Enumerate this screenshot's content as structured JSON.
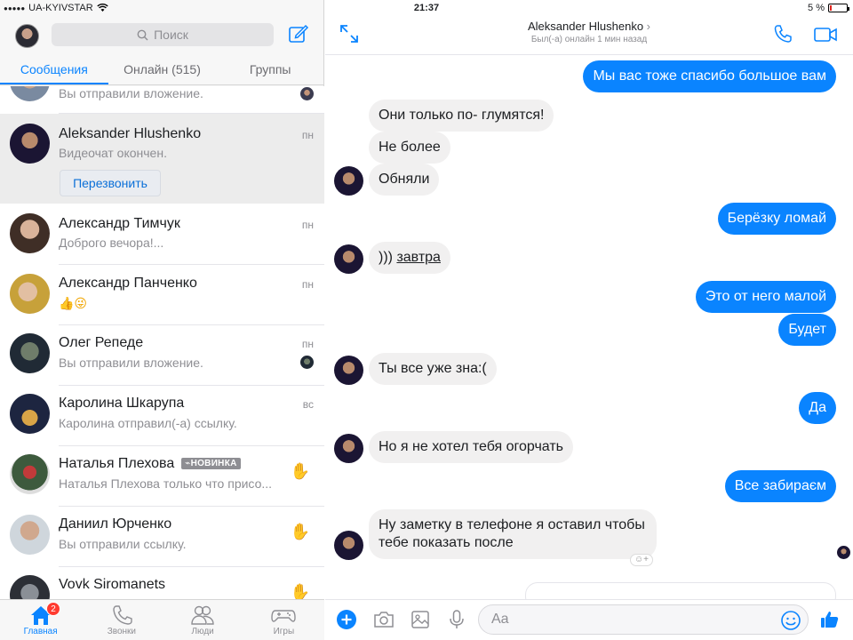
{
  "status": {
    "carrier": "UA-KYIVSTAR",
    "time": "21:37",
    "battery": "5 %",
    "battery_level": 0.05
  },
  "left": {
    "search_placeholder": "Поиск",
    "tabs": [
      {
        "label": "Сообщения",
        "active": true
      },
      {
        "label": "Онлайн (515)",
        "active": false
      },
      {
        "label": "Группы",
        "active": false
      }
    ],
    "partial_snippet": "Вы отправили вложение.",
    "conversations": [
      {
        "name": "Aleksander Hlushenko",
        "snippet": "Видеочат окончен.",
        "time": "пн",
        "action": "Перезвонить"
      },
      {
        "name": "Александр Тимчук",
        "snippet": "Доброго вечора!...",
        "time": "пн"
      },
      {
        "name": "Александр Панченко",
        "snippet": "👍😜",
        "time": "пн"
      },
      {
        "name": "Олег Репеде",
        "snippet": "Вы отправили вложение.",
        "time": "пн"
      },
      {
        "name": "Каролина Шкарупа",
        "snippet": "Каролина отправил(-а) ссылку.",
        "time": "вс"
      },
      {
        "name": "Наталья Плехова",
        "badge": "НОВИНКА",
        "snippet": "Наталья Плехова только что присо...",
        "time": ""
      },
      {
        "name": "Даниил Юрченко",
        "snippet": "Вы отправили ссылку.",
        "time": ""
      },
      {
        "name": "Vovk Siromanets",
        "snippet": "",
        "time": ""
      }
    ],
    "tabbar": [
      {
        "label": "Главная",
        "icon": "home-icon",
        "badge": "2",
        "active": true
      },
      {
        "label": "Звонки",
        "icon": "phone-icon",
        "active": false
      },
      {
        "label": "Люди",
        "icon": "people-icon",
        "active": false
      },
      {
        "label": "Игры",
        "icon": "gamepad-icon",
        "active": false
      }
    ]
  },
  "chat": {
    "title": "Aleksander Hlushenko",
    "title_chevron": "›",
    "subtitle": "Был(-а) онлайн 1 мин назад",
    "messages": [
      {
        "dir": "out",
        "text": "Мы вас тоже спасибо большое вам"
      },
      {
        "dir": "in",
        "text": "Они только по- глумятся!"
      },
      {
        "dir": "in",
        "text": "Не более"
      },
      {
        "dir": "in",
        "text": "Обняли"
      },
      {
        "dir": "out",
        "text": "Берёзку ломай"
      },
      {
        "dir": "in",
        "text": "))) ",
        "link": "завтра"
      },
      {
        "dir": "out",
        "text": "Это от него малой"
      },
      {
        "dir": "out",
        "text": "Будет"
      },
      {
        "dir": "in",
        "text": "Ты все уже зна:("
      },
      {
        "dir": "out",
        "text": "Да"
      },
      {
        "dir": "in",
        "text": "Но я не хотел тебя огорчать"
      },
      {
        "dir": "out",
        "text": "Все забираєм"
      },
      {
        "dir": "in",
        "text": "Ну заметку в телефоне я оставил чтобы тебе показать после"
      }
    ],
    "composer_placeholder": "Aa"
  },
  "colors": {
    "accent": "#0a84ff",
    "incoming": "#f1f0f0",
    "badge": "#ff3b30"
  }
}
